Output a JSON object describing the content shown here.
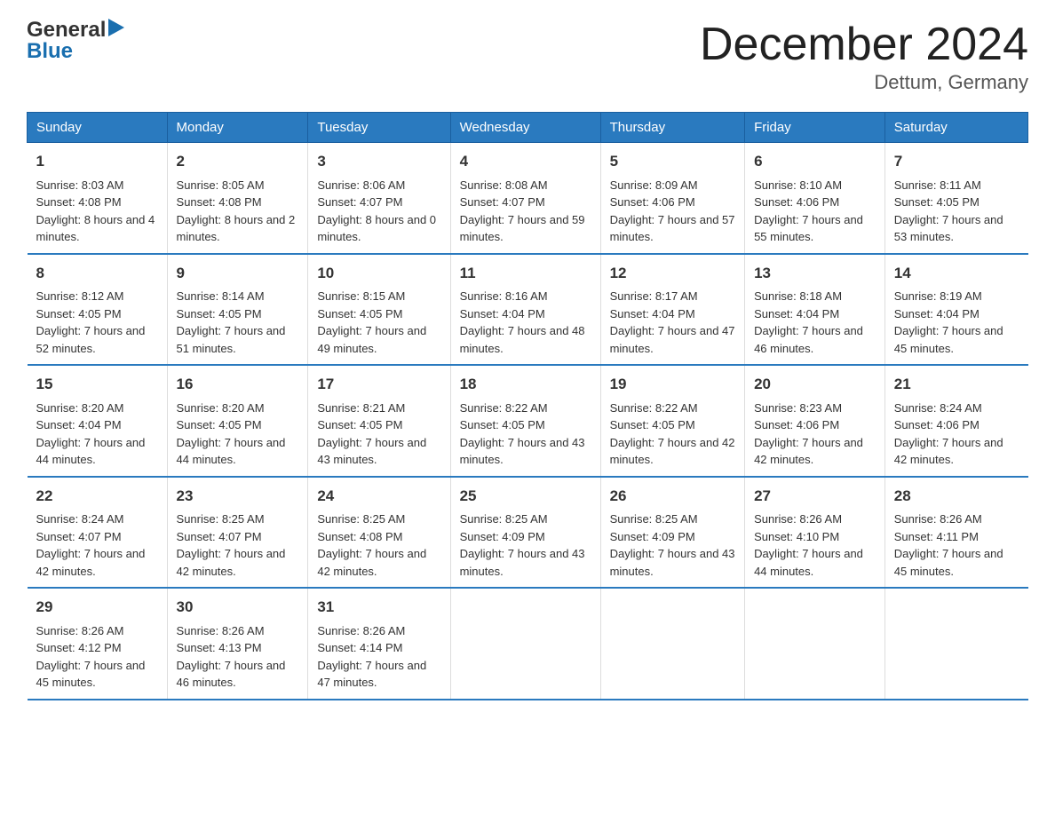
{
  "header": {
    "logo_general": "General",
    "logo_blue": "Blue",
    "title": "December 2024",
    "subtitle": "Dettum, Germany"
  },
  "columns": [
    "Sunday",
    "Monday",
    "Tuesday",
    "Wednesday",
    "Thursday",
    "Friday",
    "Saturday"
  ],
  "weeks": [
    [
      {
        "day": "1",
        "sunrise": "8:03 AM",
        "sunset": "4:08 PM",
        "daylight": "8 hours and 4 minutes."
      },
      {
        "day": "2",
        "sunrise": "8:05 AM",
        "sunset": "4:08 PM",
        "daylight": "8 hours and 2 minutes."
      },
      {
        "day": "3",
        "sunrise": "8:06 AM",
        "sunset": "4:07 PM",
        "daylight": "8 hours and 0 minutes."
      },
      {
        "day": "4",
        "sunrise": "8:08 AM",
        "sunset": "4:07 PM",
        "daylight": "7 hours and 59 minutes."
      },
      {
        "day": "5",
        "sunrise": "8:09 AM",
        "sunset": "4:06 PM",
        "daylight": "7 hours and 57 minutes."
      },
      {
        "day": "6",
        "sunrise": "8:10 AM",
        "sunset": "4:06 PM",
        "daylight": "7 hours and 55 minutes."
      },
      {
        "day": "7",
        "sunrise": "8:11 AM",
        "sunset": "4:05 PM",
        "daylight": "7 hours and 53 minutes."
      }
    ],
    [
      {
        "day": "8",
        "sunrise": "8:12 AM",
        "sunset": "4:05 PM",
        "daylight": "7 hours and 52 minutes."
      },
      {
        "day": "9",
        "sunrise": "8:14 AM",
        "sunset": "4:05 PM",
        "daylight": "7 hours and 51 minutes."
      },
      {
        "day": "10",
        "sunrise": "8:15 AM",
        "sunset": "4:05 PM",
        "daylight": "7 hours and 49 minutes."
      },
      {
        "day": "11",
        "sunrise": "8:16 AM",
        "sunset": "4:04 PM",
        "daylight": "7 hours and 48 minutes."
      },
      {
        "day": "12",
        "sunrise": "8:17 AM",
        "sunset": "4:04 PM",
        "daylight": "7 hours and 47 minutes."
      },
      {
        "day": "13",
        "sunrise": "8:18 AM",
        "sunset": "4:04 PM",
        "daylight": "7 hours and 46 minutes."
      },
      {
        "day": "14",
        "sunrise": "8:19 AM",
        "sunset": "4:04 PM",
        "daylight": "7 hours and 45 minutes."
      }
    ],
    [
      {
        "day": "15",
        "sunrise": "8:20 AM",
        "sunset": "4:04 PM",
        "daylight": "7 hours and 44 minutes."
      },
      {
        "day": "16",
        "sunrise": "8:20 AM",
        "sunset": "4:05 PM",
        "daylight": "7 hours and 44 minutes."
      },
      {
        "day": "17",
        "sunrise": "8:21 AM",
        "sunset": "4:05 PM",
        "daylight": "7 hours and 43 minutes."
      },
      {
        "day": "18",
        "sunrise": "8:22 AM",
        "sunset": "4:05 PM",
        "daylight": "7 hours and 43 minutes."
      },
      {
        "day": "19",
        "sunrise": "8:22 AM",
        "sunset": "4:05 PM",
        "daylight": "7 hours and 42 minutes."
      },
      {
        "day": "20",
        "sunrise": "8:23 AM",
        "sunset": "4:06 PM",
        "daylight": "7 hours and 42 minutes."
      },
      {
        "day": "21",
        "sunrise": "8:24 AM",
        "sunset": "4:06 PM",
        "daylight": "7 hours and 42 minutes."
      }
    ],
    [
      {
        "day": "22",
        "sunrise": "8:24 AM",
        "sunset": "4:07 PM",
        "daylight": "7 hours and 42 minutes."
      },
      {
        "day": "23",
        "sunrise": "8:25 AM",
        "sunset": "4:07 PM",
        "daylight": "7 hours and 42 minutes."
      },
      {
        "day": "24",
        "sunrise": "8:25 AM",
        "sunset": "4:08 PM",
        "daylight": "7 hours and 42 minutes."
      },
      {
        "day": "25",
        "sunrise": "8:25 AM",
        "sunset": "4:09 PM",
        "daylight": "7 hours and 43 minutes."
      },
      {
        "day": "26",
        "sunrise": "8:25 AM",
        "sunset": "4:09 PM",
        "daylight": "7 hours and 43 minutes."
      },
      {
        "day": "27",
        "sunrise": "8:26 AM",
        "sunset": "4:10 PM",
        "daylight": "7 hours and 44 minutes."
      },
      {
        "day": "28",
        "sunrise": "8:26 AM",
        "sunset": "4:11 PM",
        "daylight": "7 hours and 45 minutes."
      }
    ],
    [
      {
        "day": "29",
        "sunrise": "8:26 AM",
        "sunset": "4:12 PM",
        "daylight": "7 hours and 45 minutes."
      },
      {
        "day": "30",
        "sunrise": "8:26 AM",
        "sunset": "4:13 PM",
        "daylight": "7 hours and 46 minutes."
      },
      {
        "day": "31",
        "sunrise": "8:26 AM",
        "sunset": "4:14 PM",
        "daylight": "7 hours and 47 minutes."
      },
      null,
      null,
      null,
      null
    ]
  ]
}
